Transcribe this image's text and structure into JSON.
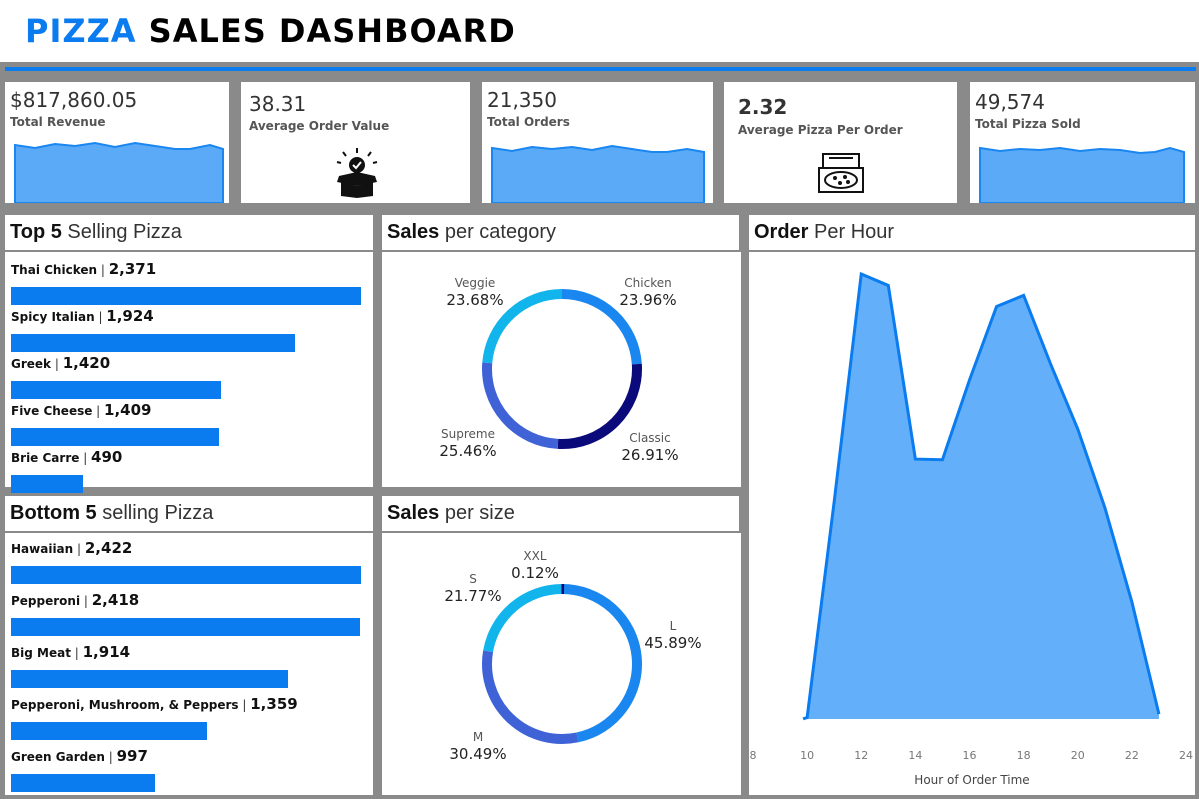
{
  "header": {
    "title_accent": "PIZZA",
    "title_rest": "SALES DASHBOARD"
  },
  "kpis": [
    {
      "value": "$817,860.05",
      "label": "Total Revenue"
    },
    {
      "value": "38.31",
      "label": "Average Order Value"
    },
    {
      "value": "21,350",
      "label": "Total Orders"
    },
    {
      "value": "2.32",
      "label": "Average Pizza Per Order"
    },
    {
      "value": "49,574",
      "label": "Total Pizza Sold"
    }
  ],
  "top5": {
    "title_bold": "Top 5",
    "title_rest": "Selling Pizza",
    "items": [
      {
        "name": "Thai Chicken",
        "value": "2,371",
        "frac": 1.0
      },
      {
        "name": "Spicy Italian",
        "value": "1,924",
        "frac": 0.811
      },
      {
        "name": "Greek",
        "value": "1,420",
        "frac": 0.599
      },
      {
        "name": "Five Cheese",
        "value": "1,409",
        "frac": 0.594
      },
      {
        "name": "Brie Carre",
        "value": "490",
        "frac": 0.207
      }
    ]
  },
  "bottom5": {
    "title_bold": "Bottom 5",
    "title_rest": "selling Pizza",
    "items": [
      {
        "name": "Hawaiian",
        "value": "2,422",
        "frac": 1.0
      },
      {
        "name": "Pepperoni",
        "value": "2,418",
        "frac": 0.998
      },
      {
        "name": "Big Meat",
        "value": "1,914",
        "frac": 0.79
      },
      {
        "name": "Pepperoni, Mushroom, & Peppers",
        "value": "1,359",
        "frac": 0.561
      },
      {
        "name": "Green Garden",
        "value": "997",
        "frac": 0.412
      }
    ]
  },
  "category": {
    "title_bold": "Sales",
    "title_rest": "per category",
    "slices": [
      {
        "name": "Chicken",
        "pct": "23.96%",
        "value": 23.96,
        "color": "#1a86f0"
      },
      {
        "name": "Classic",
        "pct": "26.91%",
        "value": 26.91,
        "color": "#0a0a7a"
      },
      {
        "name": "Supreme",
        "pct": "25.46%",
        "value": 25.46,
        "color": "#3f63d6"
      },
      {
        "name": "Veggie",
        "pct": "23.68%",
        "value": 23.68,
        "color": "#12b4ec"
      }
    ]
  },
  "size": {
    "title_bold": "Sales",
    "title_rest": "per size",
    "slices": [
      {
        "name": "L",
        "pct": "45.89%",
        "value": 45.89,
        "color": "#1a86f0"
      },
      {
        "name": "M",
        "pct": "30.49%",
        "value": 30.49,
        "color": "#3f63d6"
      },
      {
        "name": "S",
        "pct": "21.77%",
        "value": 21.77,
        "color": "#12b4ec"
      },
      {
        "name": "XXL",
        "pct": "0.12%",
        "value": 0.12,
        "color": "#0a0a7a"
      }
    ]
  },
  "hourly": {
    "title_bold": "Order",
    "title_rest": "Per Hour",
    "xlabel": "Hour of Order Time",
    "ticks": [
      "8",
      "10",
      "12",
      "14",
      "16",
      "18",
      "20",
      "22",
      "24"
    ]
  },
  "chart_data": {
    "type": "area",
    "title": "Order Per Hour",
    "xlabel": "Hour of Order Time",
    "ylabel": "",
    "xlim": [
      8,
      24
    ],
    "x": [
      9,
      10,
      11,
      12,
      13,
      14,
      15,
      16,
      17,
      18,
      19,
      20,
      21,
      22,
      23
    ],
    "values": [
      1,
      8,
      1231,
      2520,
      2455,
      1472,
      1468,
      1920,
      2336,
      2399,
      2009,
      1642,
      1198,
      663,
      28
    ],
    "color": "#0a7cf0"
  }
}
